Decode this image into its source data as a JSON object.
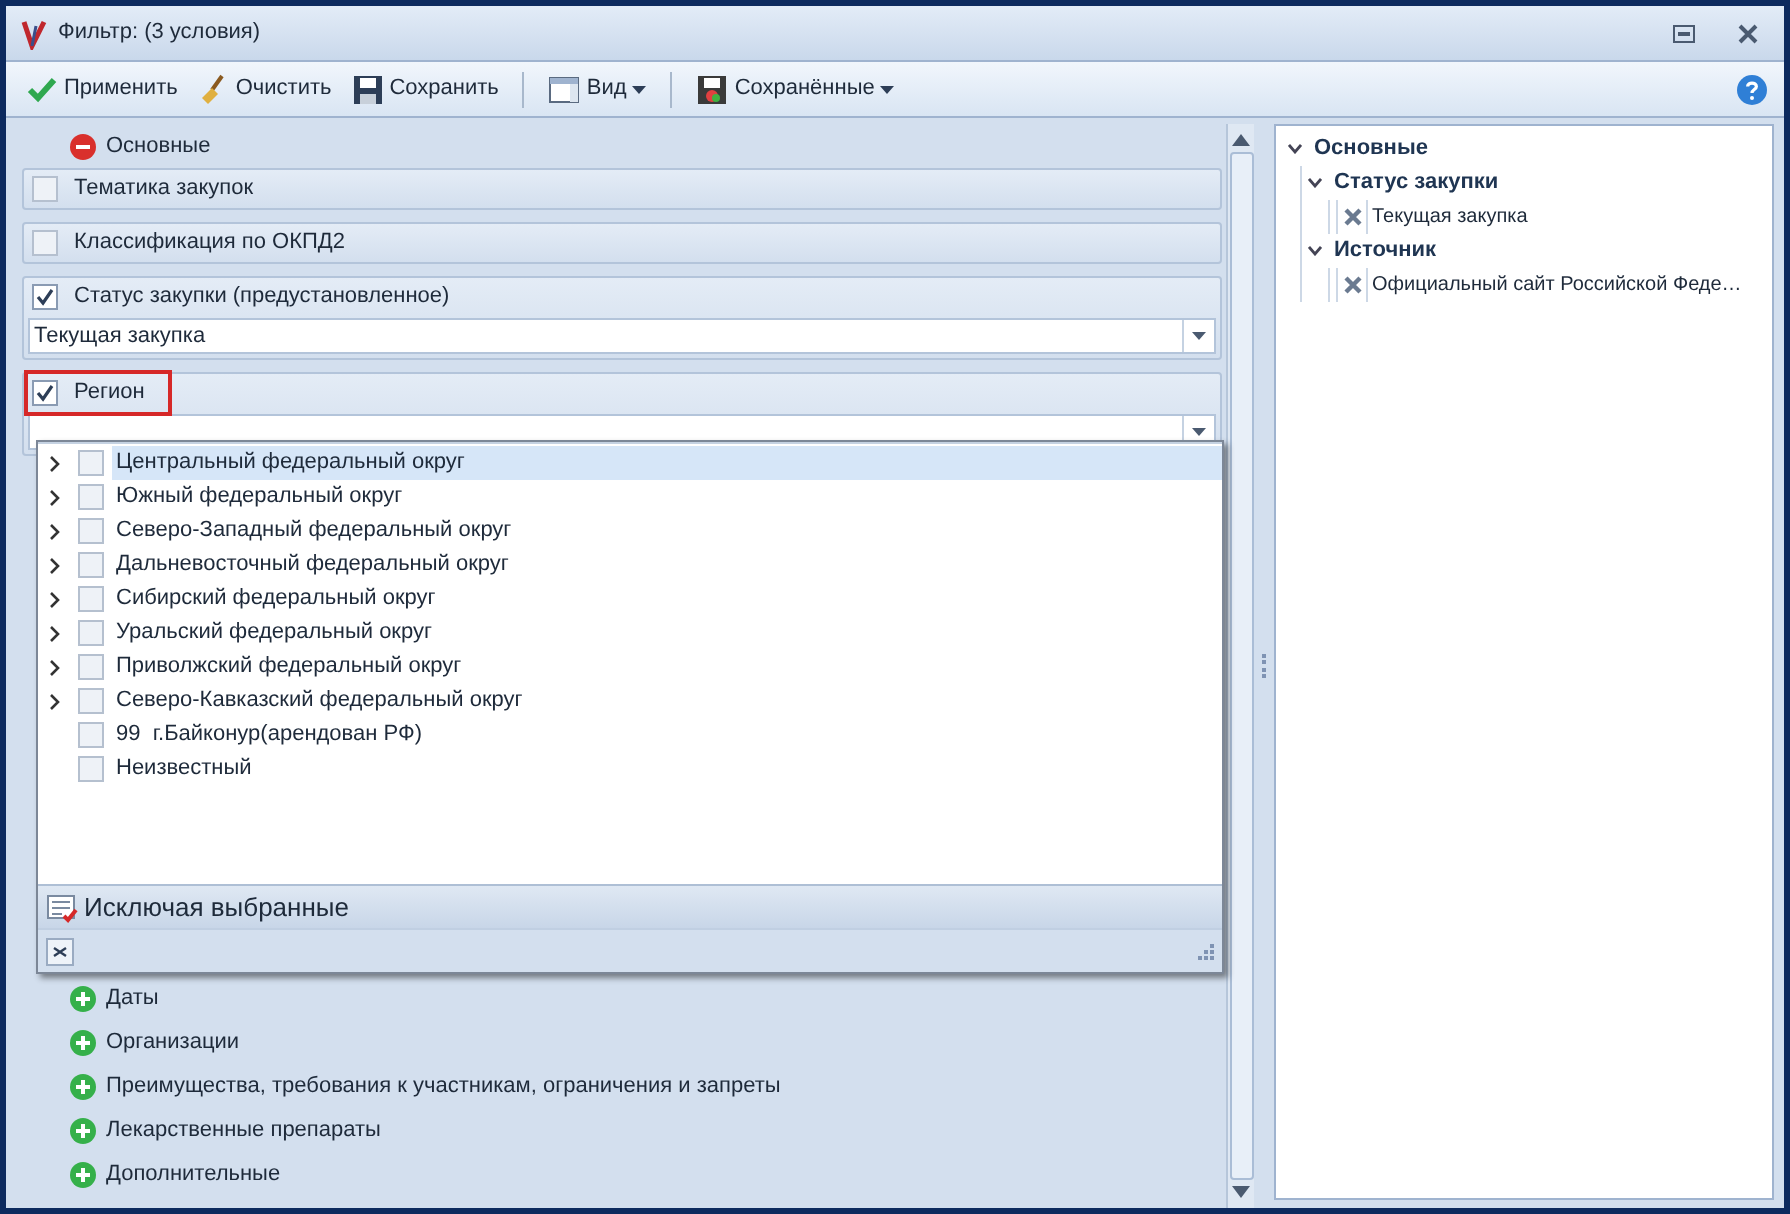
{
  "window": {
    "title": "Фильтр: (3 условия)"
  },
  "toolbar": [
    {
      "label": "Применить",
      "dropdown": false,
      "separator_before": false
    },
    {
      "label": "Очистить",
      "dropdown": false,
      "separator_before": false
    },
    {
      "label": "Сохранить",
      "dropdown": false,
      "separator_before": false
    },
    {
      "label": "Вид",
      "dropdown": true,
      "separator_before": true
    },
    {
      "label": "Сохранённые",
      "dropdown": true,
      "separator_before": true
    }
  ],
  "main_group": {
    "label": "Основные",
    "expanded": true
  },
  "conditions": [
    {
      "label": "Тематика закупок",
      "checked": false,
      "highlighted": false,
      "kind": "plain"
    },
    {
      "label": "Классификация по ОКПД2",
      "checked": false,
      "highlighted": false,
      "kind": "plain"
    },
    {
      "label": "Статус закупки (предустановленное)",
      "checked": true,
      "highlighted": false,
      "kind": "combo",
      "value": "Текущая закупка"
    },
    {
      "label": "Регион",
      "checked": true,
      "highlighted": true,
      "kind": "combo"
    }
  ],
  "region_dropdown": {
    "items": [
      {
        "label": "Центральный федеральный округ",
        "expandable": true,
        "checked": false,
        "selected": true
      },
      {
        "label": "Южный федеральный округ",
        "expandable": true,
        "checked": false,
        "selected": false
      },
      {
        "label": "Северо-Западный федеральный округ",
        "expandable": true,
        "checked": false,
        "selected": false
      },
      {
        "label": "Дальневосточный федеральный округ",
        "expandable": true,
        "checked": false,
        "selected": false
      },
      {
        "label": "Сибирский федеральный округ",
        "expandable": true,
        "checked": false,
        "selected": false
      },
      {
        "label": "Уральский федеральный округ",
        "expandable": true,
        "checked": false,
        "selected": false
      },
      {
        "label": "Приволжский федеральный округ",
        "expandable": true,
        "checked": false,
        "selected": false
      },
      {
        "label": "Северо-Кавказский федеральный округ",
        "expandable": true,
        "checked": false,
        "selected": false
      },
      {
        "label": "99  г.Байконур(арендован РФ)",
        "expandable": false,
        "checked": false,
        "selected": false
      },
      {
        "label": "Неизвестный",
        "expandable": false,
        "checked": false,
        "selected": false
      }
    ],
    "footer_label": "Исключая выбранные"
  },
  "collapsed_groups": [
    {
      "label": "Даты",
      "expanded": false
    },
    {
      "label": "Организации",
      "expanded": false
    },
    {
      "label": "Преимущества, требования к участникам, ограничения и запреты",
      "expanded": false
    },
    {
      "label": "Лекарственные препараты",
      "expanded": false
    },
    {
      "label": "Дополнительные",
      "expanded": false
    }
  ],
  "summary_tree": [
    {
      "label": "Основные",
      "kind": "group",
      "expanded": true,
      "children": [
        {
          "label": "Статус закупки",
          "kind": "group",
          "expanded": true,
          "children": [
            {
              "label": "Текущая закупка",
              "kind": "value"
            }
          ]
        },
        {
          "label": "Источник",
          "kind": "group",
          "expanded": true,
          "children": [
            {
              "label": "Официальный сайт Российской Феде…",
              "kind": "value"
            }
          ]
        }
      ]
    }
  ]
}
